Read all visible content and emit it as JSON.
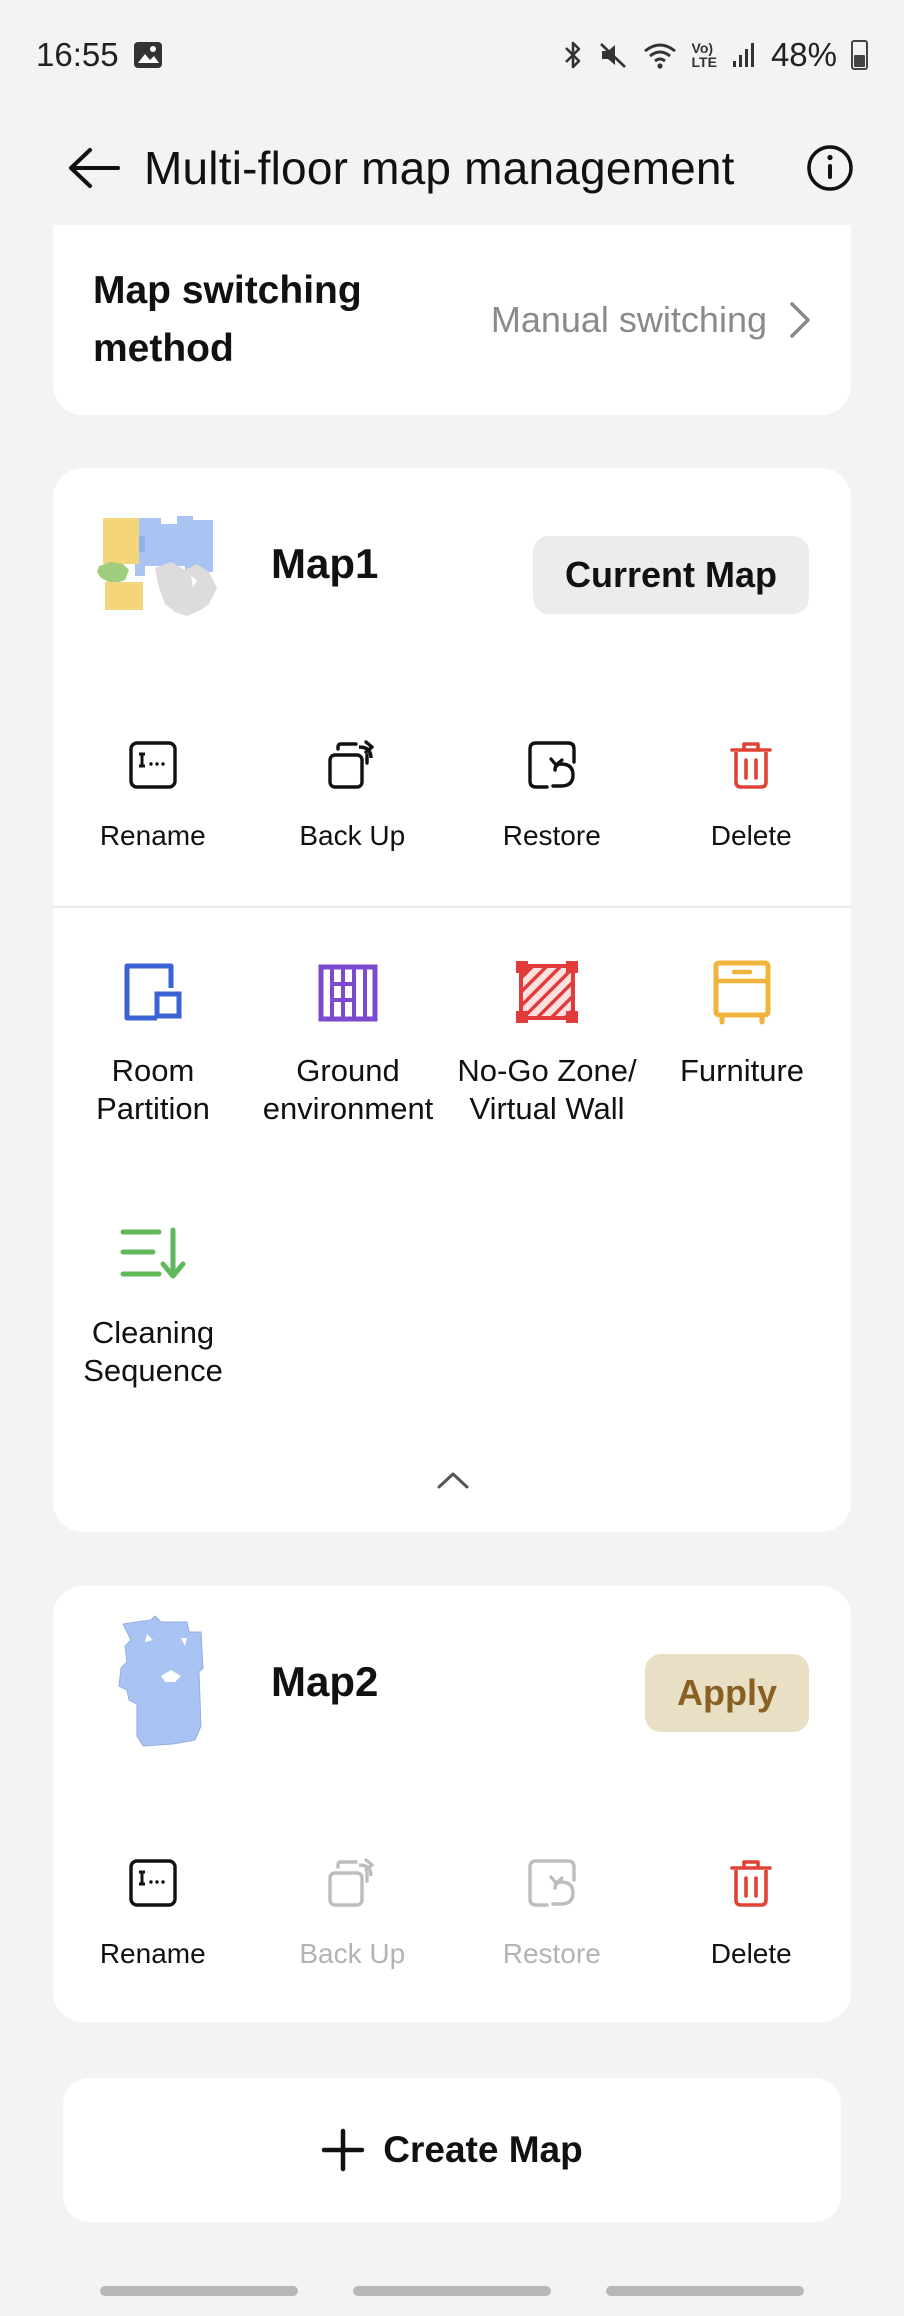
{
  "status_bar": {
    "time": "16:55",
    "battery_percent": "48%",
    "icons": [
      "image-icon",
      "bluetooth-icon",
      "mute-icon",
      "wifi-icon",
      "volte-icon",
      "signal-icon",
      "battery-icon"
    ],
    "volte_top": "Vo)",
    "volte_bottom": "LTE"
  },
  "header": {
    "title": "Multi-floor map management"
  },
  "map_switching": {
    "label": "Map switching method",
    "value": "Manual switching"
  },
  "maps": [
    {
      "name": "Map1",
      "status_label": "Current Map",
      "actions": [
        {
          "label": "Rename",
          "icon": "rename-icon",
          "enabled": true
        },
        {
          "label": "Back Up",
          "icon": "backup-icon",
          "enabled": true
        },
        {
          "label": "Restore",
          "icon": "restore-icon",
          "enabled": true
        },
        {
          "label": "Delete",
          "icon": "trash-icon",
          "enabled": true
        }
      ],
      "tools": [
        {
          "label_line1": "Room",
          "label_line2": "Partition",
          "icon": "room-partition-icon",
          "color": "#3a63d6"
        },
        {
          "label_line1": "Ground",
          "label_line2": "environment",
          "icon": "ground-environment-icon",
          "color": "#7b4ad1"
        },
        {
          "label_line1": "No-Go Zone/",
          "label_line2": "Virtual Wall",
          "icon": "no-go-zone-icon",
          "color": "#e23b3b"
        },
        {
          "label_line1": "Furniture",
          "label_line2": "",
          "icon": "furniture-icon",
          "color": "#f0b43c"
        },
        {
          "label_line1": "Cleaning",
          "label_line2": "Sequence",
          "icon": "cleaning-sequence-icon",
          "color": "#5fb85a"
        }
      ]
    },
    {
      "name": "Map2",
      "status_label": "Apply",
      "actions": [
        {
          "label": "Rename",
          "icon": "rename-icon",
          "enabled": true
        },
        {
          "label": "Back Up",
          "icon": "backup-icon",
          "enabled": false
        },
        {
          "label": "Restore",
          "icon": "restore-icon",
          "enabled": false
        },
        {
          "label": "Delete",
          "icon": "trash-icon",
          "enabled": true
        }
      ]
    }
  ],
  "create_map": {
    "label": "Create Map"
  },
  "colors": {
    "delete": "#e04335",
    "apply_bg": "#e9dfc5",
    "apply_text": "#8a5f22",
    "disabled": "#b3b3b3"
  }
}
